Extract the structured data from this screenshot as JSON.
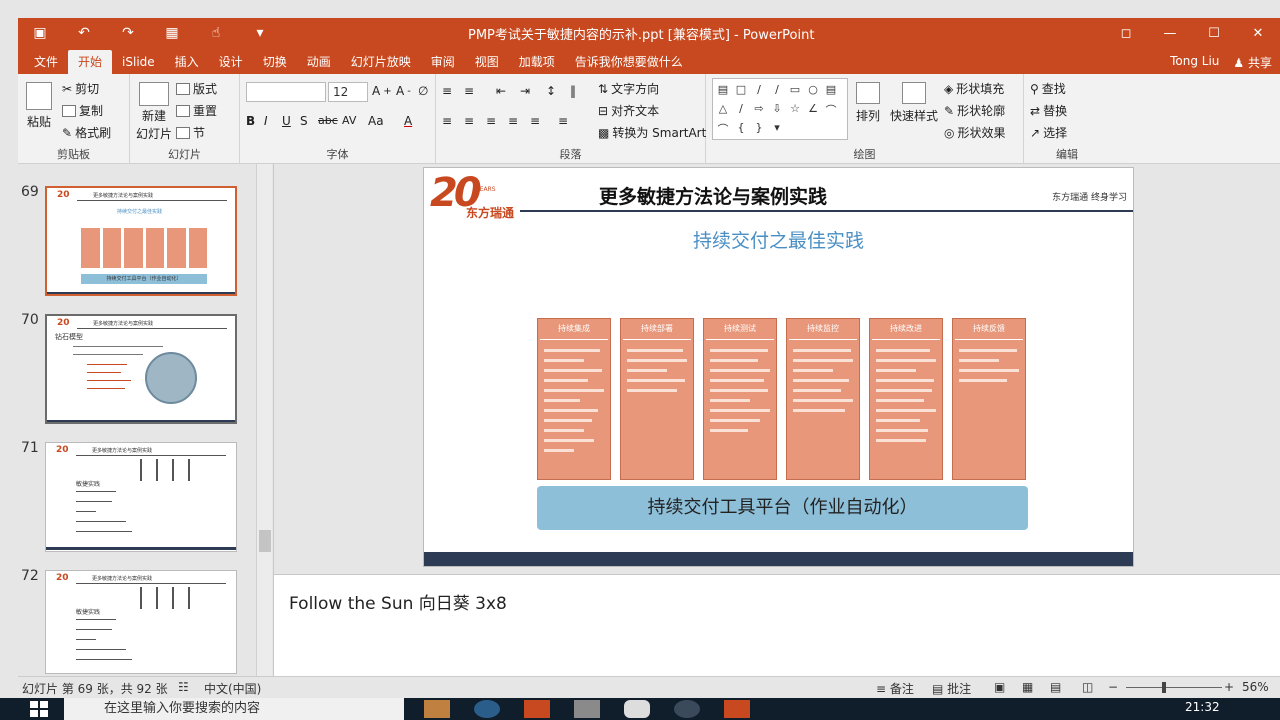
{
  "window": {
    "title": "PMP考试关于敏捷内容的示补.ppt [兼容模式] - PowerPoint",
    "user": "Tong Liu",
    "share": "共享"
  },
  "tabs": [
    "文件",
    "开始",
    "iSlide",
    "插入",
    "设计",
    "切换",
    "动画",
    "幻灯片放映",
    "审阅",
    "视图",
    "加载项"
  ],
  "tell_me": "告诉我你想要做什么",
  "ribbon": {
    "clipboard": {
      "paste": "粘贴",
      "cut": "剪切",
      "copy": "复制",
      "format_painter": "格式刷",
      "label": "剪贴板"
    },
    "slides": {
      "new_slide": "新建",
      "new_slide2": "幻灯片",
      "layout": "版式",
      "reset": "重置",
      "section": "节",
      "label": "幻灯片"
    },
    "font": {
      "size": "12",
      "label": "字体",
      "bold": "B",
      "italic": "I",
      "underline": "U",
      "strike": "abc",
      "spacing": "AV",
      "case": "Aa",
      "color": "A"
    },
    "paragraph": {
      "text_direction": "文字方向",
      "align_text": "对齐文本",
      "smartart": "转换为 SmartArt",
      "label": "段落"
    },
    "drawing": {
      "arrange": "排列",
      "quick_styles": "快速样式",
      "fill": "形状填充",
      "outline": "形状轮廓",
      "effects": "形状效果",
      "label": "绘图"
    },
    "editing": {
      "find": "查找",
      "replace": "替换",
      "select": "选择",
      "label": "编辑"
    }
  },
  "thumbnails": [
    {
      "num": "69",
      "title": "更多敏捷方法论与案例实践",
      "subtitle": "持续交付之最佳实践",
      "footer": "持续交付工具平台（作业自动化）"
    },
    {
      "num": "70",
      "title": "更多敏捷方法论与案例实践",
      "subtitle": "钻石模型"
    },
    {
      "num": "71",
      "title": "更多敏捷方法论与案例实践",
      "subtitle": "敏捷实践"
    },
    {
      "num": "72",
      "title": "更多敏捷方法论与案例实践",
      "subtitle": "敏捷实践"
    }
  ],
  "slide": {
    "logo_number": "20",
    "logo_years": "YEARS",
    "logo_brand": "东方瑞通",
    "header": "更多敏捷方法论与案例实践",
    "header_right": "东方瑞通  终身学习",
    "title": "持续交付之最佳实践",
    "columns": [
      {
        "head": "持续集成"
      },
      {
        "head": "持续部署"
      },
      {
        "head": "持续测试"
      },
      {
        "head": "持续监控"
      },
      {
        "head": "持续改进"
      },
      {
        "head": "持续反馈"
      }
    ],
    "tool_platform": "持续交付工具平台（作业自动化）"
  },
  "notes": "Follow the Sun 向日葵 3x8",
  "status": {
    "slide_info": "幻灯片 第 69 张，共 92 张",
    "language": "中文(中国)",
    "notes_btn": "备注",
    "comments_btn": "批注",
    "zoom": "56%",
    "zoom_level": 0.56
  },
  "taskbar": {
    "search_placeholder": "在这里输入你要搜索的内容",
    "time": "21:32"
  },
  "colors": {
    "accent": "#c8491f",
    "column_fill": "#e8977a",
    "tool_bar": "#8ebfd9",
    "title_blue": "#4a8fc4"
  }
}
